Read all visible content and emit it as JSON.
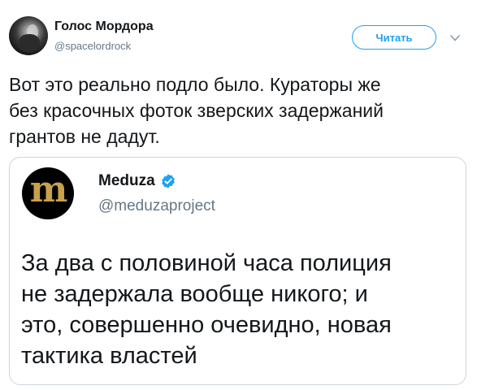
{
  "tweet": {
    "author_name": "Голос Мордора",
    "author_handle": "@spacelordrock",
    "follow_label": "Читать",
    "text_lines": [
      "Вот это реально подло было. Кураторы же",
      "без красочных фоток зверских задержаний",
      "грантов не дадут."
    ]
  },
  "quoted": {
    "avatar_letter": "m",
    "author_name": "Meduza",
    "author_handle": "@meduzaproject",
    "text_lines": [
      "За два с половиной часа полиция",
      "не задержала вообще никого; и",
      "это, совершенно очевидно, новая",
      "тактика властей"
    ]
  },
  "colors": {
    "accent": "#1da1f2",
    "text": "#14171a",
    "muted": "#657786",
    "border": "#ccd6dd",
    "meduza_gold": "#c8a24a"
  },
  "icons": {
    "caret": "chevron-down-icon",
    "verified": "verified-badge-icon"
  }
}
